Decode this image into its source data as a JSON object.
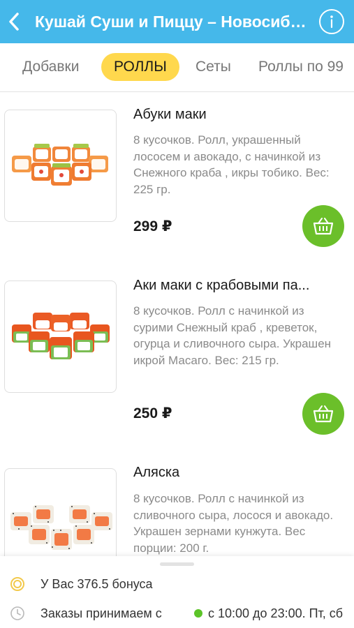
{
  "header": {
    "title": "Кушай Суши и Пиццу – Новосибирск",
    "bg_color": "#45b8ea"
  },
  "tabs": [
    {
      "label": "Добавки",
      "active": false
    },
    {
      "label": "РОЛЛЫ",
      "active": true
    },
    {
      "label": "Сеты",
      "active": false
    },
    {
      "label": "Роллы по 99",
      "active": false
    }
  ],
  "products": [
    {
      "name": "Абуки маки",
      "description": "8 кусочков.  Ролл, украшенный лососем и авокадо, с начинкой из  Снежного краба , икры тобико. Вес: 225 гр.",
      "price": "299 ₽",
      "image_icon": "sushi-roll-image"
    },
    {
      "name": "Аки маки с крабовыми па...",
      "description": "8 кусочков. Ролл с начинкой из сурими  Снежный краб , креветок, огурца и сливочного сыра. Украшен икрой Масаго. Вес: 215 гр.",
      "price": "250 ₽",
      "image_icon": "sushi-roll-image"
    },
    {
      "name": "Аляска",
      "description": "8 кусочков. Ролл с начинкой из сливочного сыра, лосося и авокадо. Украшен зернами кунжута. Вес порции: 200 г.",
      "price": "",
      "image_icon": "sushi-roll-image"
    }
  ],
  "bottom": {
    "bonus_text": "У Вас 376.5 бонуса",
    "orders_text": "Заказы принимаем с",
    "hours_text": "с 10:00 до 23:00. Пт, сб",
    "accent_green": "#6bbf2a",
    "bonus_icon": "coin-icon",
    "clock_icon": "clock-icon"
  }
}
